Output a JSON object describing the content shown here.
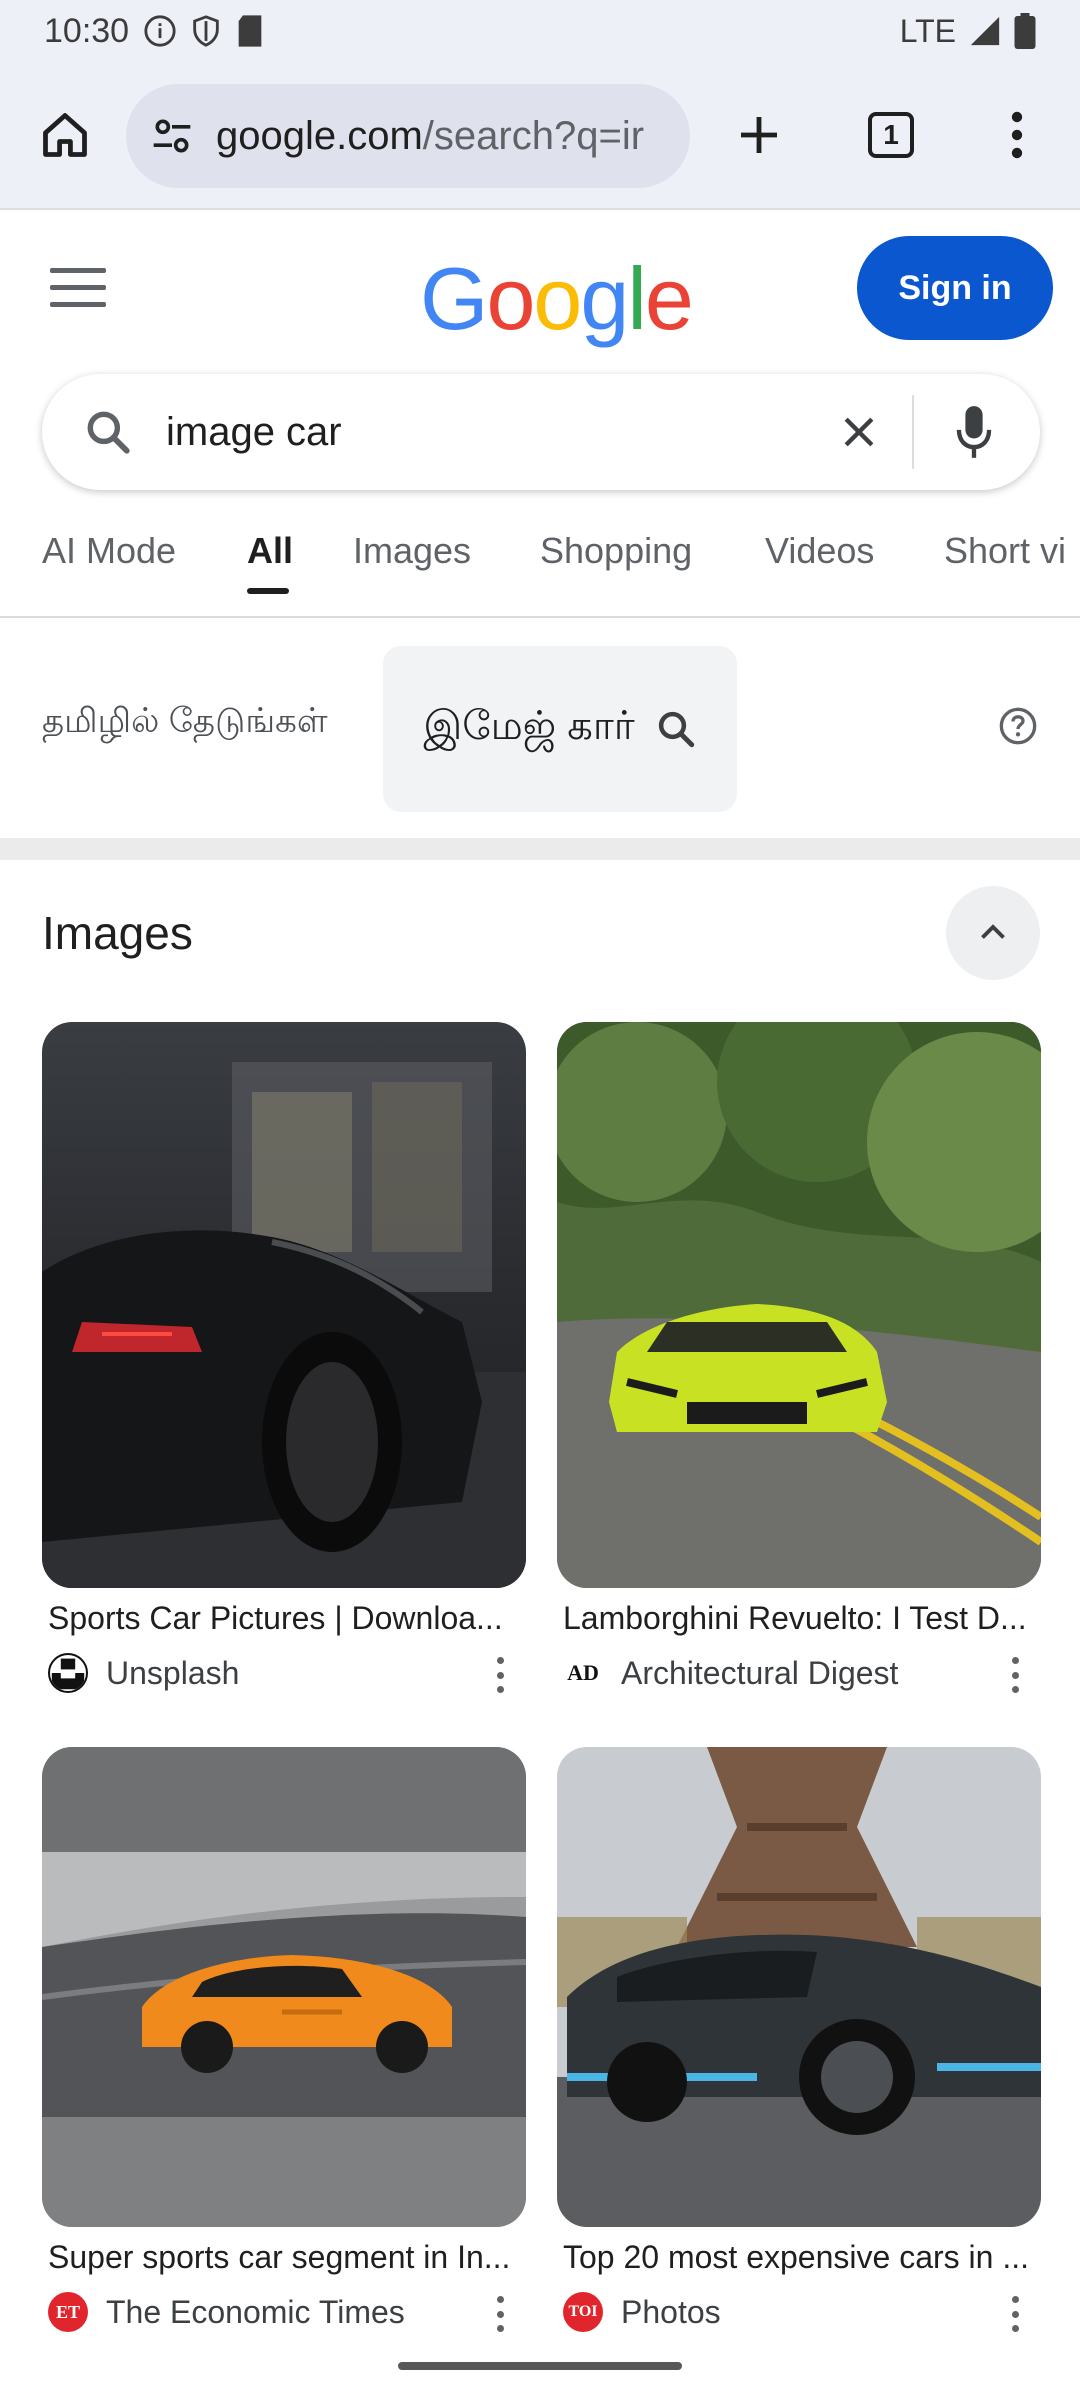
{
  "status_bar": {
    "time": "10:30",
    "network": "LTE"
  },
  "browser": {
    "url_host": "google.com",
    "url_path": "/search?q=ir",
    "tab_count": "1"
  },
  "header": {
    "logo": [
      "G",
      "o",
      "o",
      "g",
      "l",
      "e"
    ],
    "sign_in": "Sign in"
  },
  "search": {
    "query": "image car"
  },
  "tabs": [
    "AI Mode",
    "All",
    "Images",
    "Shopping",
    "Videos",
    "Short vi"
  ],
  "active_tab": "All",
  "tamil": {
    "hint": "தமிழில் தேடுங்கள்",
    "chip": "இமேஜ் கார்"
  },
  "images_section": {
    "heading": "Images",
    "results": [
      {
        "title": "Sports Car Pictures | Downloa...",
        "source": "Unsplash"
      },
      {
        "title": "Lamborghini Revuelto: I Test D...",
        "source": "Architectural Digest"
      },
      {
        "title": "Super sports car segment in In...",
        "source": "The Economic Times"
      },
      {
        "title": "Top 20 most expensive cars in ...",
        "source": "Photos"
      }
    ]
  },
  "source_logos": {
    "economic_times": "ET",
    "toi": "TOI",
    "ad": "AD"
  },
  "colors": {
    "accent": "#0b57d0",
    "logo_blue": "#4285f4",
    "logo_red": "#ea4335",
    "logo_yellow": "#fbbc05",
    "logo_green": "#34a853"
  }
}
